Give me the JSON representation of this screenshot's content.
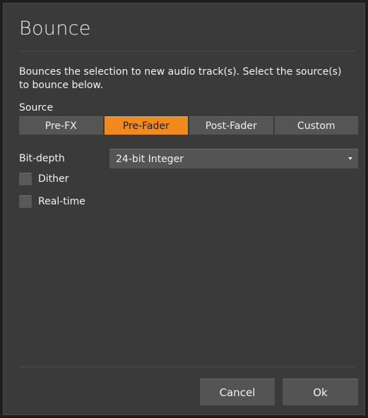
{
  "dialog": {
    "title": "Bounce",
    "description": "Bounces the selection to new audio track(s). Select the source(s) to bounce below."
  },
  "source": {
    "label": "Source",
    "options": [
      "Pre-FX",
      "Pre-Fader",
      "Post-Fader",
      "Custom"
    ],
    "selected": "Pre-Fader"
  },
  "bit_depth": {
    "label": "Bit-depth",
    "value": "24-bit Integer"
  },
  "options": {
    "dither_label": "Dither",
    "dither_checked": false,
    "realtime_label": "Real-time",
    "realtime_checked": false
  },
  "buttons": {
    "cancel": "Cancel",
    "ok": "Ok"
  },
  "colors": {
    "accent": "#f08a1c",
    "dialog_bg": "#3a3a3a",
    "control_bg": "#555555"
  }
}
